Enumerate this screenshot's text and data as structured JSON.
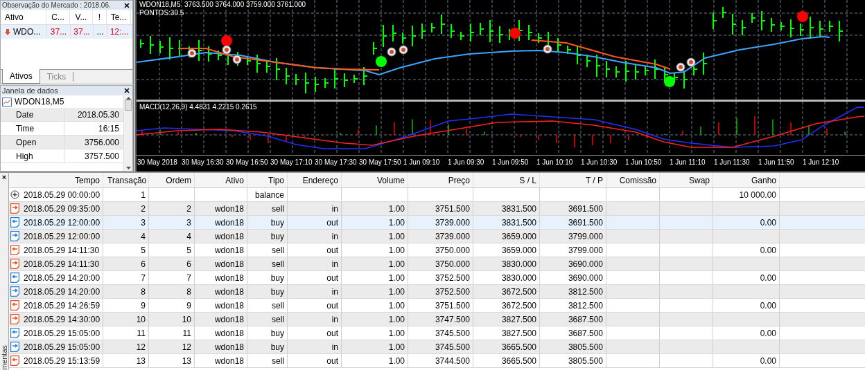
{
  "market_watch": {
    "title": "Observação do Mercado : 2018.06.",
    "columns": [
      "Ativo",
      "C...",
      "V...",
      "!",
      "Te..."
    ],
    "rows": [
      {
        "symbol": "WDO...",
        "bid": "37...",
        "ask": "37...",
        "flag": "...",
        "time": "12:...",
        "selected": true
      }
    ],
    "tabs": [
      {
        "label": "Ativos",
        "selected": true
      },
      {
        "label": "Ticks",
        "selected": false
      }
    ]
  },
  "data_window": {
    "title": "Janela de dados",
    "symbol": "WDON18,M5",
    "rows": [
      {
        "label": "Date",
        "value": "2018.05.30"
      },
      {
        "label": "Time",
        "value": "16:15"
      },
      {
        "label": "Open",
        "value": "3756.000"
      },
      {
        "label": "High",
        "value": "3757.500"
      }
    ]
  },
  "chart": {
    "header": "WDON18,M5  3763.500 3764.000 3759.000 3761.000",
    "points_label": "PONTOS:30.5",
    "macd_label": "MACD(12,26,9) 4.4831 4.2215 0.2615",
    "time_labels": [
      "30 May 2018",
      "30 May 16:30",
      "30 May 16:50",
      "30 May 17:10",
      "30 May 17:30",
      "30 May 17:50",
      "1 Jun 09:10",
      "1 Jun 09:30",
      "1 Jun 09:50",
      "1 Jun 10:10",
      "1 Jun 10:30",
      "1 Jun 10:50",
      "1 Jun 11:10",
      "1 Jun 11:30",
      "1 Jun 11:50",
      "1 Jun 12:10"
    ]
  },
  "toolbox": {
    "side_label": "mentas",
    "close": "×"
  },
  "table": {
    "columns": [
      "Tempo",
      "Transação",
      "Ordem",
      "Ativo",
      "Tipo",
      "Endereço",
      "Volume",
      "Preço",
      "S / L",
      "T / P",
      "Comissão",
      "Swap",
      "Ganho"
    ],
    "rows": [
      {
        "kind": "balance",
        "selected": false,
        "cells": [
          "2018.05.29 00:00:00",
          "1",
          "",
          "",
          "balance",
          "",
          "",
          "",
          "",
          "",
          "",
          "",
          "10 000.00"
        ]
      },
      {
        "kind": "sell-in",
        "selected": false,
        "cells": [
          "2018.05.29 09:35:00",
          "2",
          "2",
          "wdon18",
          "sell",
          "in",
          "1.00",
          "3751.500",
          "3831.500",
          "3691.500",
          "",
          "",
          ""
        ]
      },
      {
        "kind": "buy-out",
        "selected": true,
        "cells": [
          "2018.05.29 12:00:00",
          "3",
          "3",
          "wdon18",
          "buy",
          "out",
          "1.00",
          "3739.000",
          "3831.500",
          "3691.500",
          "",
          "",
          "0.00"
        ]
      },
      {
        "kind": "buy-in",
        "selected": false,
        "cells": [
          "2018.05.29 12:00:00",
          "4",
          "4",
          "wdon18",
          "buy",
          "in",
          "1.00",
          "3739.000",
          "3659.000",
          "3799.000",
          "",
          "",
          ""
        ]
      },
      {
        "kind": "sell-out",
        "selected": false,
        "cells": [
          "2018.05.29 14:11:30",
          "5",
          "5",
          "wdon18",
          "sell",
          "out",
          "1.00",
          "3750.000",
          "3659.000",
          "3799.000",
          "",
          "",
          "0.00"
        ]
      },
      {
        "kind": "sell-in",
        "selected": false,
        "cells": [
          "2018.05.29 14:11:30",
          "6",
          "6",
          "wdon18",
          "sell",
          "in",
          "1.00",
          "3750.000",
          "3830.000",
          "3690.000",
          "",
          "",
          ""
        ]
      },
      {
        "kind": "buy-out",
        "selected": false,
        "cells": [
          "2018.05.29 14:20:00",
          "7",
          "7",
          "wdon18",
          "buy",
          "out",
          "1.00",
          "3752.500",
          "3830.000",
          "3690.000",
          "",
          "",
          "0.00"
        ]
      },
      {
        "kind": "buy-in",
        "selected": false,
        "cells": [
          "2018.05.29 14:20:00",
          "8",
          "8",
          "wdon18",
          "buy",
          "in",
          "1.00",
          "3752.500",
          "3672.500",
          "3812.500",
          "",
          "",
          ""
        ]
      },
      {
        "kind": "sell-out",
        "selected": false,
        "cells": [
          "2018.05.29 14:26:59",
          "9",
          "9",
          "wdon18",
          "sell",
          "out",
          "1.00",
          "3751.500",
          "3672.500",
          "3812.500",
          "",
          "",
          "0.00"
        ]
      },
      {
        "kind": "sell-in",
        "selected": false,
        "cells": [
          "2018.05.29 14:30:00",
          "10",
          "10",
          "wdon18",
          "sell",
          "in",
          "1.00",
          "3747.500",
          "3827.500",
          "3687.500",
          "",
          "",
          ""
        ]
      },
      {
        "kind": "buy-out",
        "selected": false,
        "cells": [
          "2018.05.29 15:05:00",
          "11",
          "11",
          "wdon18",
          "buy",
          "out",
          "1.00",
          "3745.500",
          "3827.500",
          "3687.500",
          "",
          "",
          "0.00"
        ]
      },
      {
        "kind": "buy-in",
        "selected": false,
        "cells": [
          "2018.05.29 15:05:00",
          "12",
          "12",
          "wdon18",
          "buy",
          "in",
          "1.00",
          "3745.500",
          "3665.500",
          "3805.500",
          "",
          "",
          ""
        ]
      },
      {
        "kind": "sell-out",
        "selected": false,
        "cells": [
          "2018.05.29 15:13:59",
          "13",
          "13",
          "wdon18",
          "sell",
          "out",
          "1.00",
          "3744.500",
          "3665.500",
          "3805.500",
          "",
          "",
          "0.00"
        ]
      }
    ]
  }
}
